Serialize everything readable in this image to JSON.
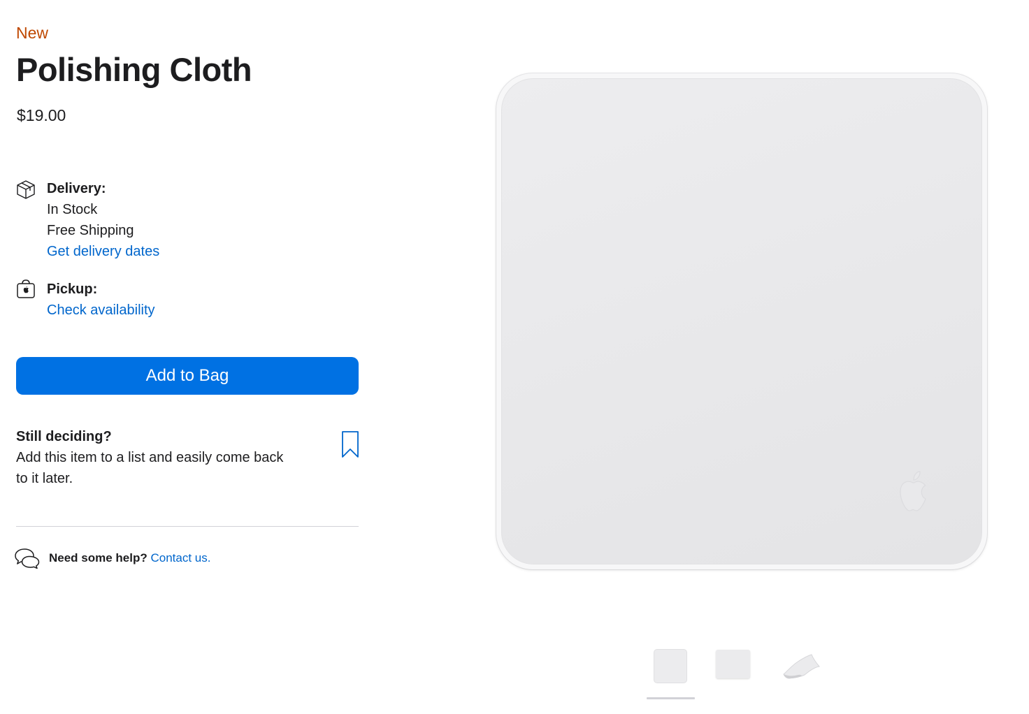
{
  "product": {
    "badge": "New",
    "title": "Polishing Cloth",
    "price": "$19.00"
  },
  "delivery": {
    "label": "Delivery:",
    "stock": "In Stock",
    "shipping": "Free Shipping",
    "link": "Get delivery dates",
    "icon": "box-icon"
  },
  "pickup": {
    "label": "Pickup:",
    "link": "Check availability",
    "icon": "shopping-bag-icon"
  },
  "cta": {
    "add_to_bag": "Add to Bag"
  },
  "save": {
    "heading": "Still deciding?",
    "body": "Add this item to a list and easily come back to it later.",
    "icon": "bookmark-icon"
  },
  "help": {
    "prompt": "Need some help?",
    "link": "Contact us.",
    "icon": "chat-bubbles-icon"
  },
  "gallery": {
    "selected_index": 0,
    "thumbnail_count": 3
  },
  "colors": {
    "badge": "#bf4800",
    "link": "#0066cc",
    "button": "#0071e3"
  }
}
